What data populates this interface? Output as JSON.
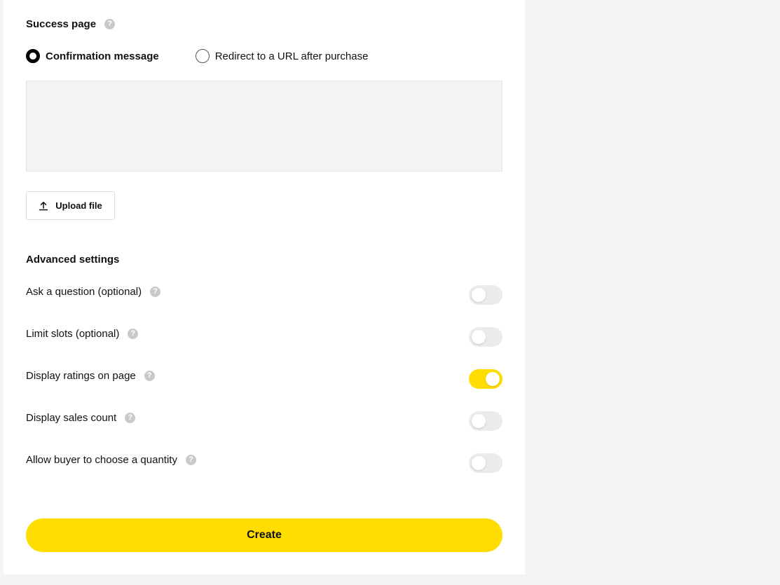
{
  "success_page": {
    "title": "Success page",
    "help": "?",
    "options": [
      {
        "label": "Confirmation message",
        "selected": true
      },
      {
        "label": "Redirect to a URL after purchase",
        "selected": false
      }
    ],
    "message_value": "",
    "upload_label": "Upload file"
  },
  "advanced": {
    "title": "Advanced settings",
    "settings": [
      {
        "label": "Ask a question (optional)",
        "help": "?",
        "enabled": false
      },
      {
        "label": "Limit slots (optional)",
        "help": "?",
        "enabled": false
      },
      {
        "label": "Display ratings on page",
        "help": "?",
        "enabled": true
      },
      {
        "label": "Display sales count",
        "help": "?",
        "enabled": false
      },
      {
        "label": "Allow buyer to choose a quantity",
        "help": "?",
        "enabled": false
      }
    ]
  },
  "create_label": "Create",
  "colors": {
    "accent": "#ffdd00",
    "toggle_off": "#ebebeb",
    "help_icon": "#c9c9c9"
  }
}
